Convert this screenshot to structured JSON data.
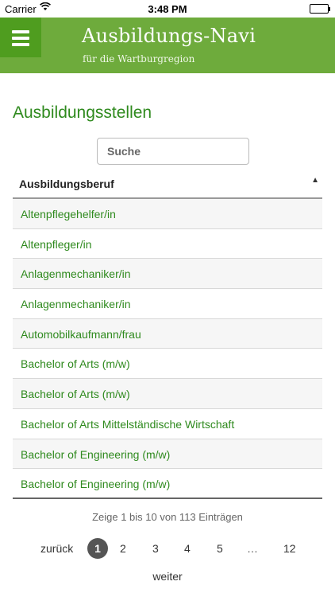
{
  "status_bar": {
    "carrier": "Carrier",
    "wifi_icon": "wifi-icon",
    "time": "3:48 PM",
    "battery_icon": "battery-icon",
    "battery_level": 1.0
  },
  "header": {
    "title": "Ausbildungs-Navi",
    "subtitle": "für die Wartburgregion",
    "menu_icon": "hamburger-menu-icon",
    "colors": {
      "bar": "#6eab3c",
      "menu_button": "#4f9d1f"
    }
  },
  "page": {
    "title": "Ausbildungsstellen",
    "accent_color": "#2f8a1e"
  },
  "search": {
    "placeholder": "Suche",
    "value": ""
  },
  "table": {
    "column_header": "Ausbildungsberuf",
    "sort_icon": "sort-ascending-icon",
    "sort_glyph": "▲",
    "rows": [
      "Altenpflegehelfer/in",
      "Altenpfleger/in",
      "Anlagenmechaniker/in",
      "Anlagenmechaniker/in",
      "Automobilkaufmann/frau",
      "Bachelor of Arts (m/w)",
      "Bachelor of Arts (m/w)",
      "Bachelor of Arts Mittelständische Wirtschaft",
      "Bachelor of Engineering (m/w)",
      "Bachelor of Engineering (m/w)"
    ]
  },
  "footer": {
    "info": "Zeige 1 bis 10 von 113 Einträgen",
    "pagination": {
      "prev": "zurück",
      "pages": [
        "1",
        "2",
        "3",
        "4",
        "5"
      ],
      "current": "1",
      "ellipsis": "…",
      "last": "12",
      "next": "weiter"
    }
  }
}
